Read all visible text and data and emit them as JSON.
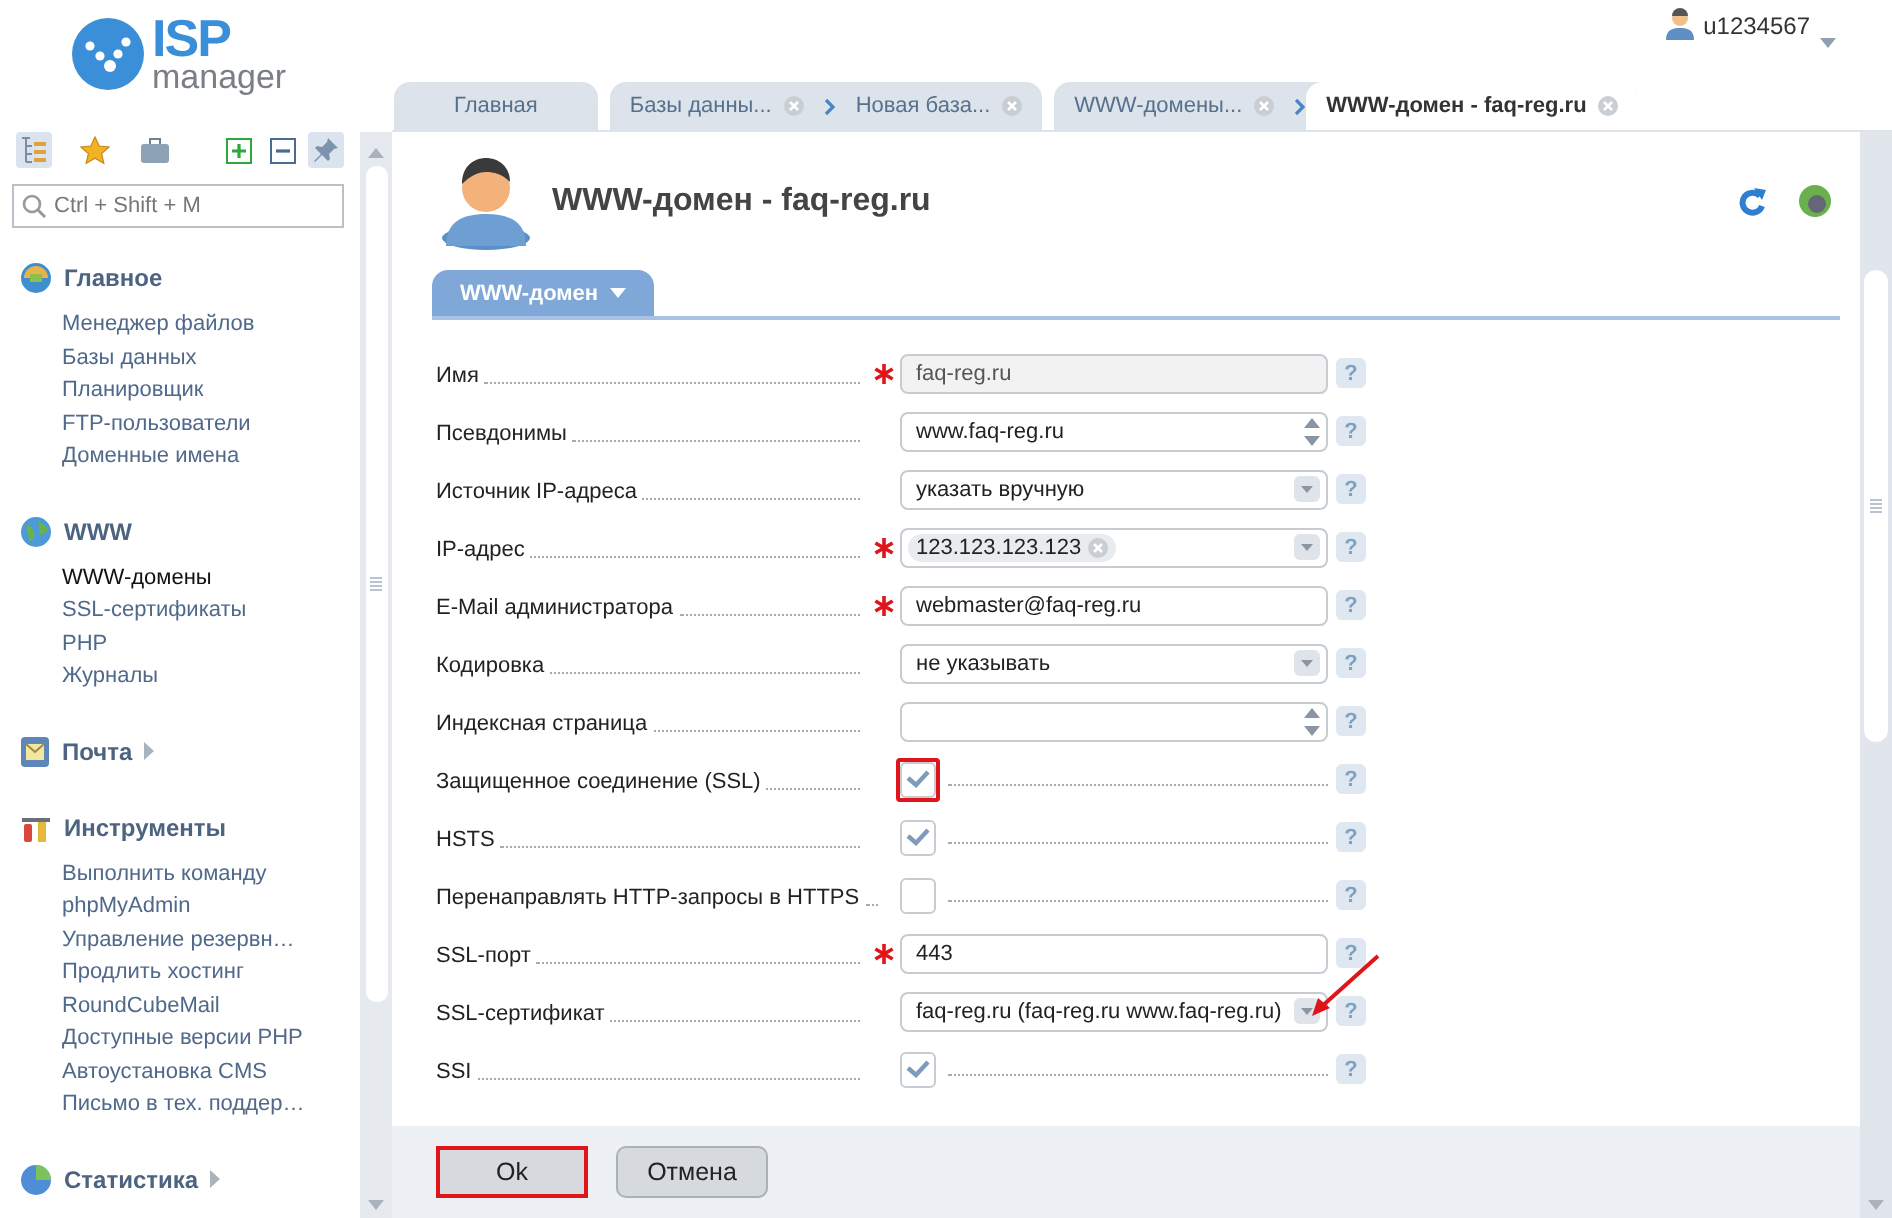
{
  "logo": {
    "mark": "ISP",
    "word": "manager"
  },
  "user": {
    "name": "u1234567"
  },
  "tabs": [
    {
      "pages": [
        {
          "label": "Главная",
          "closable": false,
          "selected": false
        }
      ]
    },
    {
      "pages": [
        {
          "label": "Базы данны...",
          "closable": true,
          "selected": false
        },
        {
          "label": "Новая база...",
          "closable": true,
          "selected": false
        }
      ]
    },
    {
      "pages": [
        {
          "label": "WWW-домены...",
          "closable": true,
          "selected": false
        },
        {
          "label": "WWW-домен - faq-reg.ru",
          "closable": true,
          "selected": true
        }
      ]
    }
  ],
  "sidebar": {
    "toolbar": [
      {
        "kind": "tree",
        "selected": true
      },
      {
        "kind": "star",
        "selected": false
      },
      {
        "kind": "case",
        "selected": false
      },
      {
        "kind": "expand",
        "selected": false
      },
      {
        "kind": "collapse",
        "selected": false
      },
      {
        "kind": "pin",
        "selected": true
      }
    ],
    "search": {
      "placeholder": "Ctrl + Shift + M"
    },
    "groups": [
      {
        "kind": "home",
        "title": "Главное",
        "expanded": true,
        "items": [
          {
            "label": "Менеджер файлов",
            "selected": false
          },
          {
            "label": "Базы данных",
            "selected": false
          },
          {
            "label": "Планировщик",
            "selected": false
          },
          {
            "label": "FTP-пользователи",
            "selected": false
          },
          {
            "label": "Доменные имена",
            "selected": false
          }
        ]
      },
      {
        "kind": "globe",
        "title": "WWW",
        "expanded": true,
        "items": [
          {
            "label": "WWW-домены",
            "selected": true
          },
          {
            "label": "SSL-сертификаты",
            "selected": false
          },
          {
            "label": "PHP",
            "selected": false
          },
          {
            "label": "Журналы",
            "selected": false
          }
        ]
      },
      {
        "kind": "mail",
        "title": "Почта",
        "expanded": false
      },
      {
        "kind": "tools",
        "title": "Инструменты",
        "expanded": true,
        "items": [
          {
            "label": "Выполнить команду",
            "selected": false
          },
          {
            "label": "phpMyAdmin",
            "selected": false
          },
          {
            "label": "Управление резервн…",
            "selected": false
          },
          {
            "label": "Продлить хостинг",
            "selected": false
          },
          {
            "label": "RoundCubeMail",
            "selected": false
          },
          {
            "label": "Доступные версии PHP",
            "selected": false
          },
          {
            "label": "Автоустановка CMS",
            "selected": false
          },
          {
            "label": "Письмо в тех. поддер…",
            "selected": false
          }
        ]
      },
      {
        "kind": "stats",
        "title": "Статистика",
        "expanded": false
      }
    ]
  },
  "title": "WWW-домен - faq-reg.ru",
  "form_tab": {
    "label": "WWW-домен"
  },
  "fields": [
    {
      "kind": "text",
      "label": "Имя",
      "required": true,
      "readonly": true,
      "value": "faq-reg.ru",
      "help": "?"
    },
    {
      "kind": "list",
      "label": "Псевдонимы",
      "required": false,
      "value": "www.faq-reg.ru",
      "help": "?"
    },
    {
      "kind": "select",
      "label": "Источник IP-адреса",
      "required": false,
      "value": "указать вручную",
      "help": "?"
    },
    {
      "kind": "tags",
      "label": "IP-адрес",
      "required": true,
      "tags": [
        "123.123.123.123"
      ],
      "help": "?"
    },
    {
      "kind": "text",
      "label": "E-Mail администратора",
      "required": true,
      "readonly": false,
      "value": "webmaster@faq-reg.ru",
      "help": "?"
    },
    {
      "kind": "select",
      "label": "Кодировка",
      "required": false,
      "value": "не указывать",
      "help": "?"
    },
    {
      "kind": "list",
      "label": "Индексная страница",
      "required": false,
      "help": "?"
    },
    {
      "kind": "checkbox",
      "label": "Защищенное соединение (SSL)",
      "required": false,
      "checked": true,
      "highlighted": true,
      "help": "?"
    },
    {
      "kind": "checkbox",
      "label": "HSTS",
      "required": false,
      "checked": true,
      "highlighted": false,
      "help": "?"
    },
    {
      "kind": "checkbox",
      "label": "Перенаправлять HTTP-запросы в HTTPS",
      "required": false,
      "checked": false,
      "highlighted": false,
      "help": "?"
    },
    {
      "kind": "text",
      "label": "SSL-порт",
      "required": true,
      "readonly": false,
      "value": "443",
      "help": "?"
    },
    {
      "kind": "select",
      "label": "SSL-сертификат",
      "required": false,
      "value": "faq-reg.ru (faq-reg.ru www.faq-reg.ru)",
      "arrow": true,
      "help": "?"
    },
    {
      "kind": "checkbox",
      "label": "SSI",
      "required": false,
      "checked": true,
      "highlighted": false,
      "help": "?"
    }
  ],
  "buttons": [
    {
      "label": "Ok",
      "highlighted": true
    },
    {
      "label": "Отмена",
      "highlighted": false
    }
  ]
}
